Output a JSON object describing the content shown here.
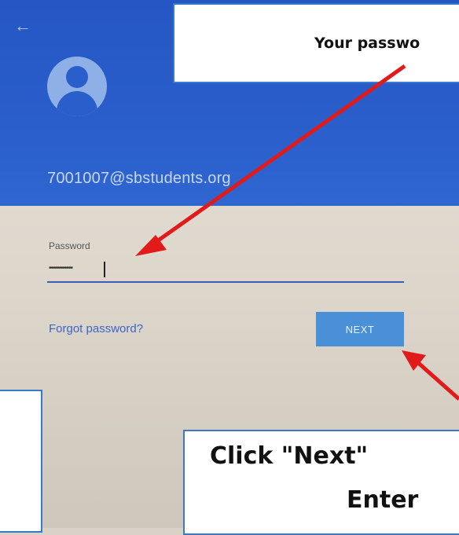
{
  "header": {
    "back_icon": "arrow-left-icon",
    "avatar_icon": "person-icon",
    "email": "7001007@sbstudents.org"
  },
  "form": {
    "password_label": "Password",
    "password_value": "••••••••••••",
    "forgot_link": "Forgot password?",
    "next_button": "NEXT"
  },
  "annotations": {
    "top_callout": "Your passwo",
    "bottom_callout_line1": "Click \"Next\"",
    "bottom_callout_line2": "Enter",
    "arrow_color": "#e11a1a"
  },
  "colors": {
    "header_blue": "#2a5ecb",
    "button_blue": "#4a90d9",
    "link_blue": "#3a66c9"
  }
}
